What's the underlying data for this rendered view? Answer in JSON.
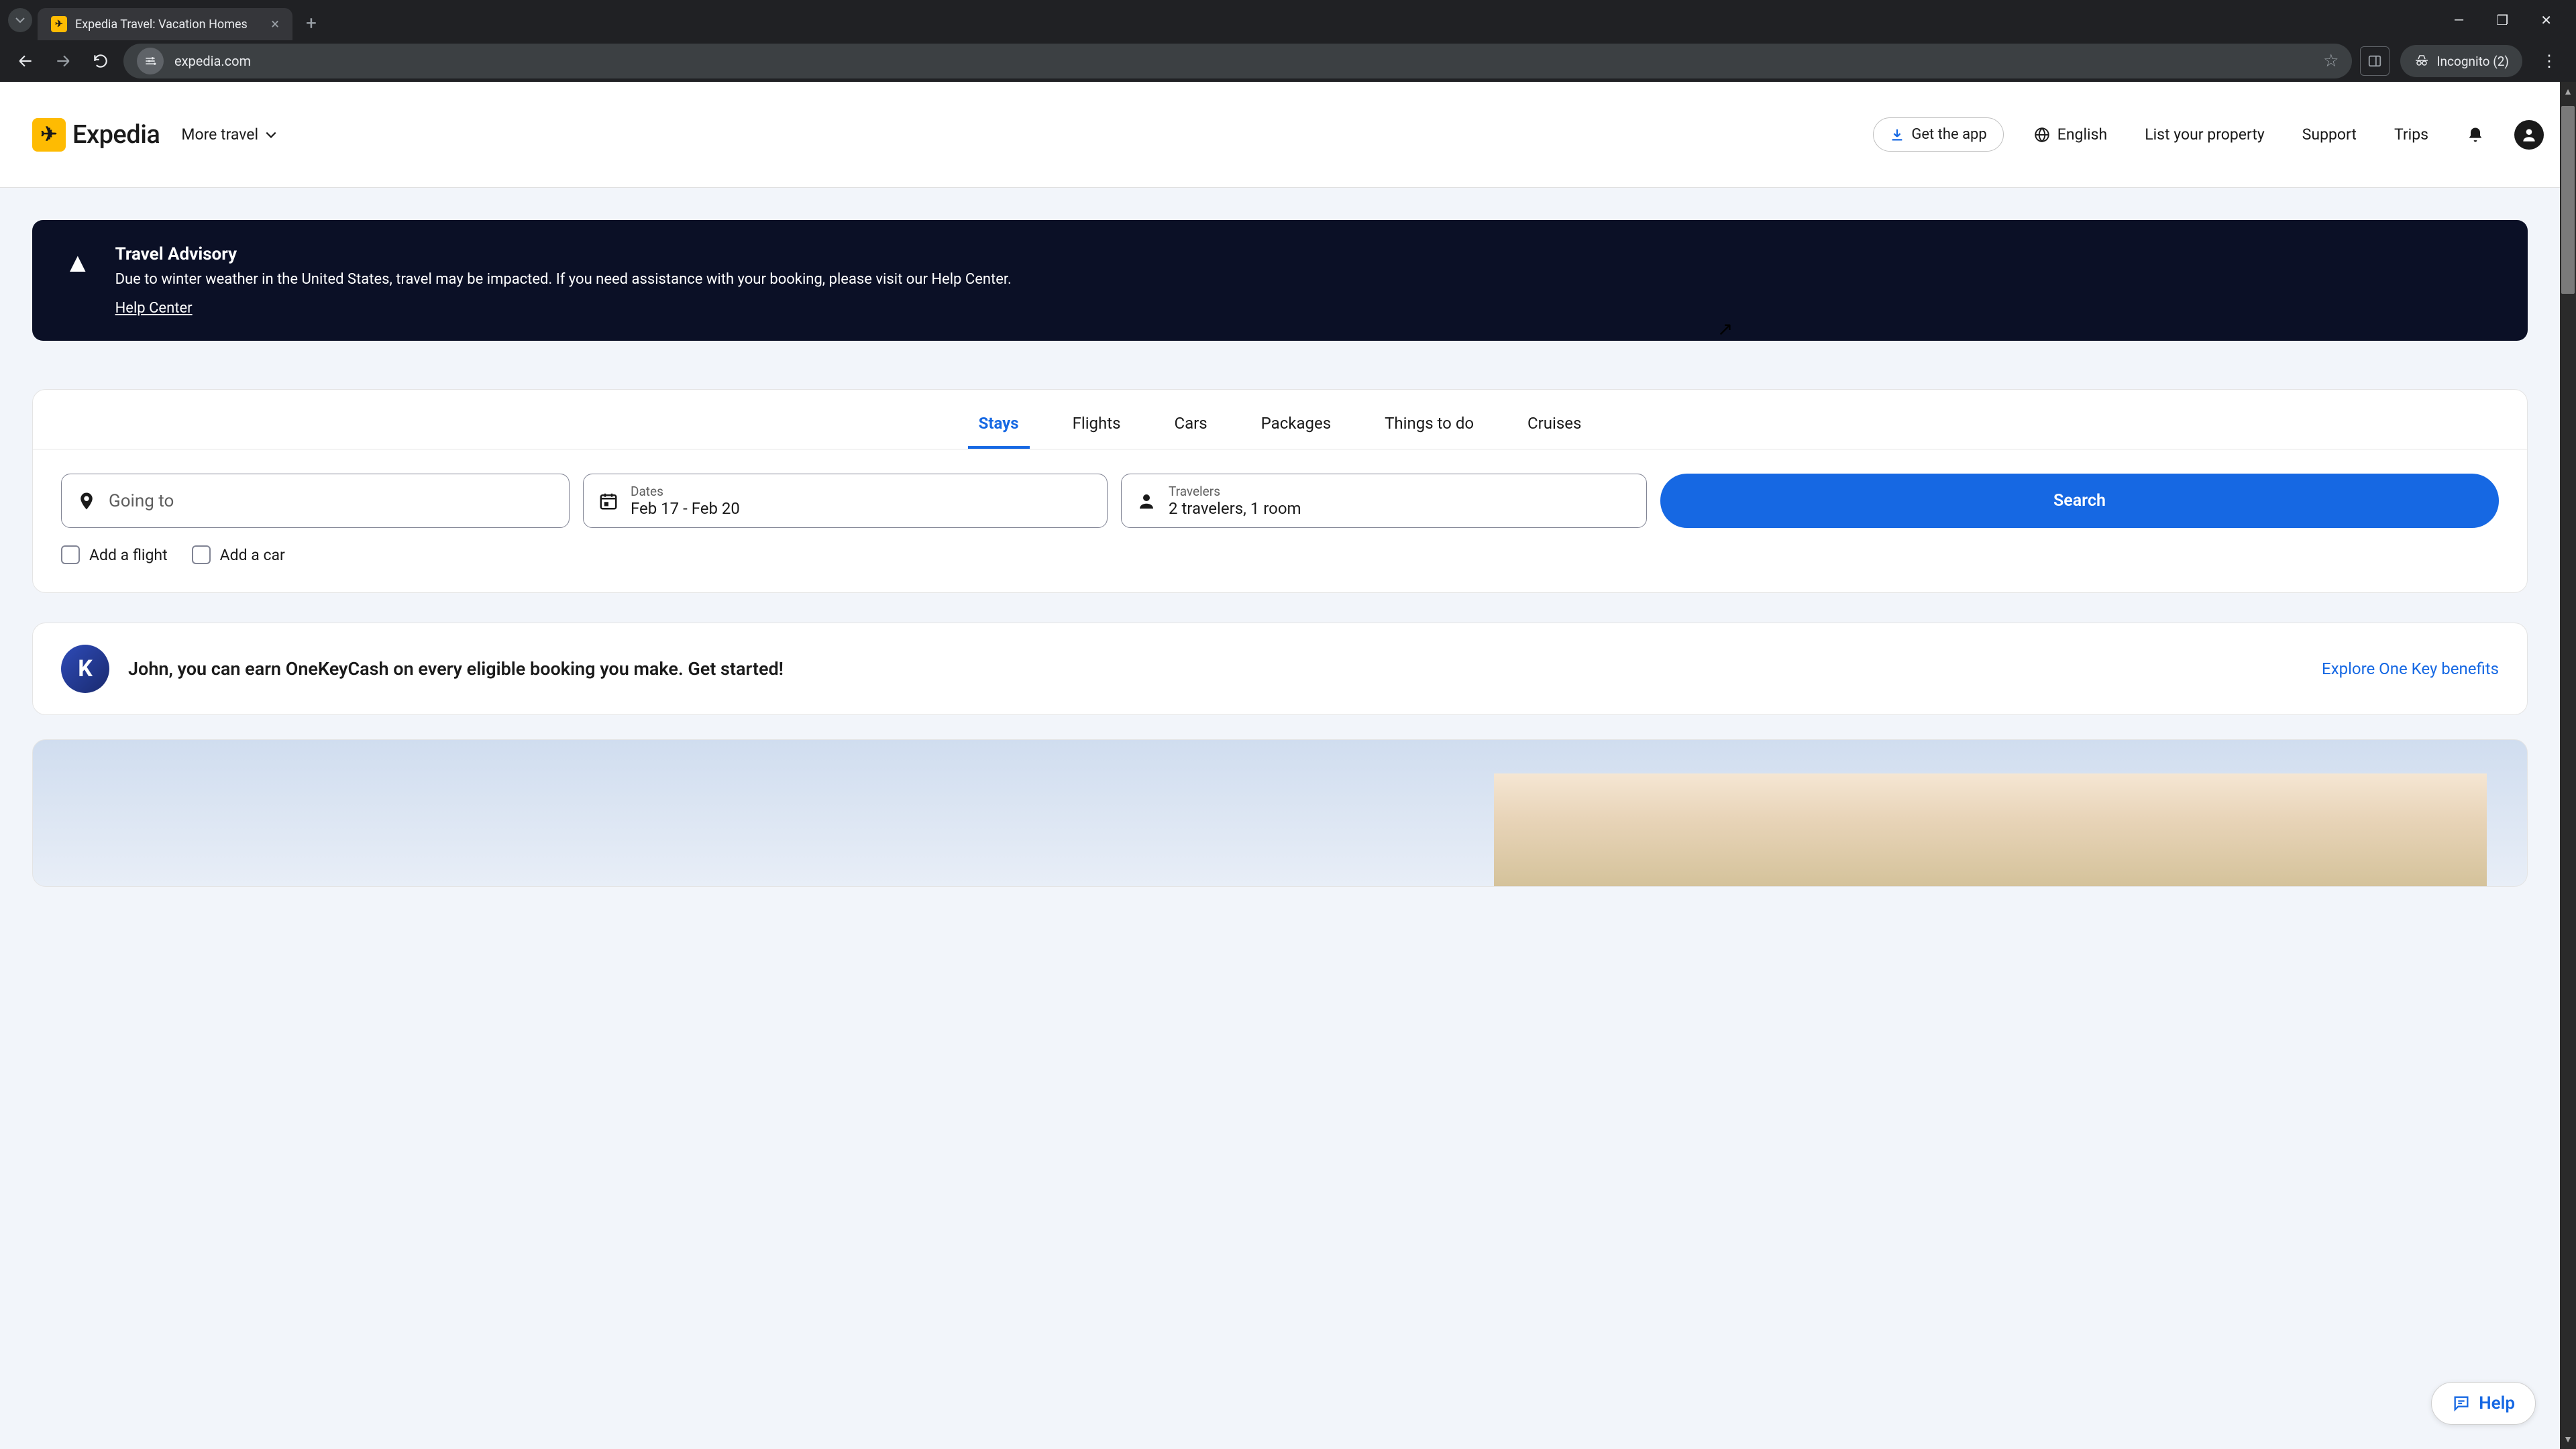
{
  "browser": {
    "tab_title": "Expedia Travel: Vacation Homes",
    "url": "expedia.com",
    "incognito_label": "Incognito (2)"
  },
  "header": {
    "logo_text": "Expedia",
    "more_travel": "More travel",
    "get_app": "Get the app",
    "language": "English",
    "list_property": "List your property",
    "support": "Support",
    "trips": "Trips"
  },
  "advisory": {
    "title": "Travel Advisory",
    "text": "Due to winter weather in the United States, travel may be impacted. If you need assistance with your booking, please visit our Help Center.",
    "link": "Help Center"
  },
  "tabs": [
    "Stays",
    "Flights",
    "Cars",
    "Packages",
    "Things to do",
    "Cruises"
  ],
  "search": {
    "going_placeholder": "Going to",
    "dates_label": "Dates",
    "dates_value": "Feb 17 - Feb 20",
    "travelers_label": "Travelers",
    "travelers_value": "2 travelers, 1 room",
    "button": "Search",
    "add_flight": "Add a flight",
    "add_car": "Add a car"
  },
  "promo": {
    "badge_letter": "K",
    "text": "John, you can earn OneKeyCash on every eligible booking you make. Get started!",
    "link": "Explore One Key benefits"
  },
  "help_label": "Help"
}
